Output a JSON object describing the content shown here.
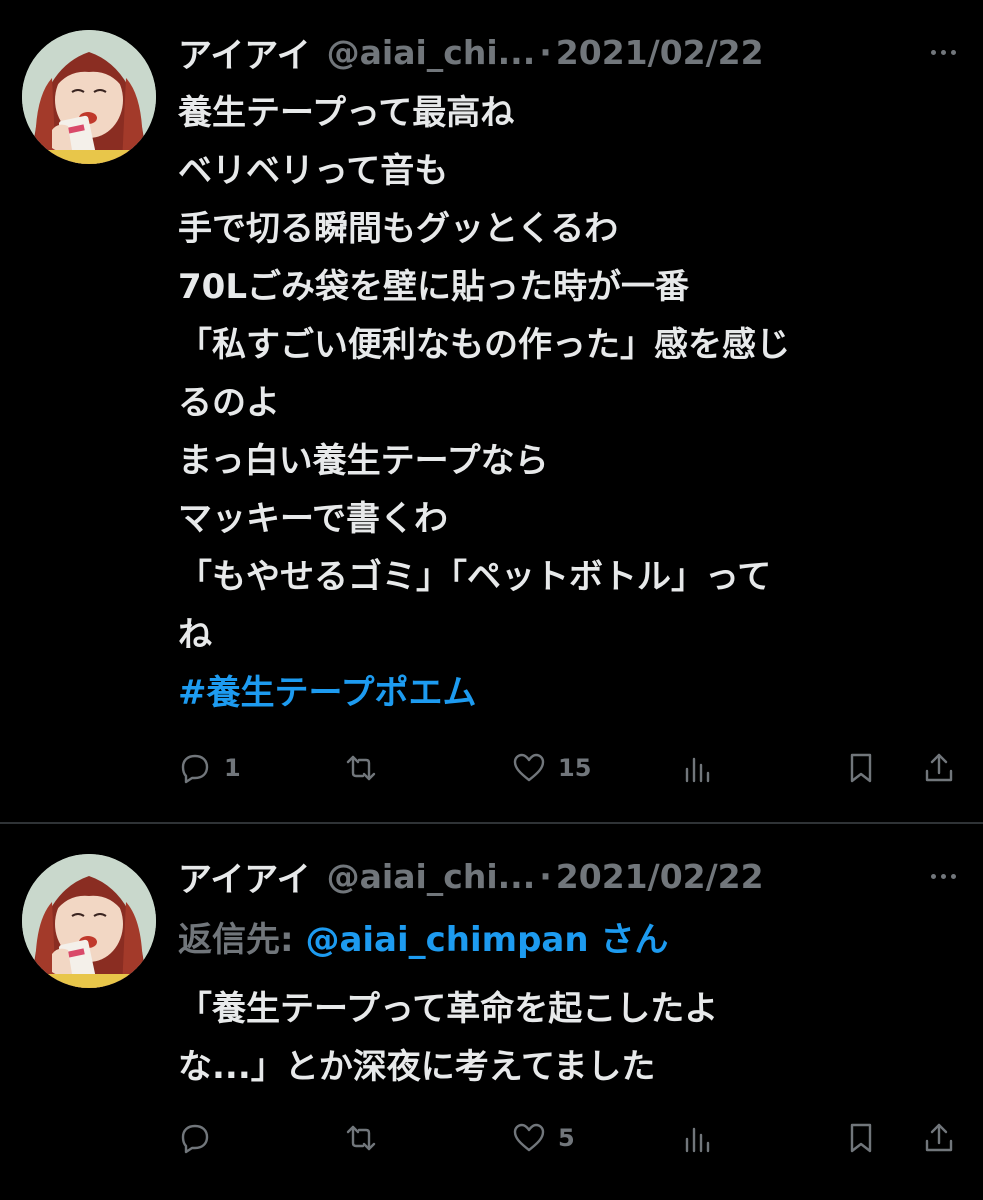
{
  "colors": {
    "background": "#000000",
    "text": "#e7e9ea",
    "muted": "#71767b",
    "accent": "#1d9bf0",
    "divider": "#2f3336"
  },
  "tweets": [
    {
      "name": "アイアイ",
      "handle": "@aiai_chi...",
      "separator": "·",
      "date": "2021/02/22",
      "lines": [
        "養生テープって最高ね",
        "ベリベリって音も",
        "手で切る瞬間もグッとくるわ",
        "70Lごみ袋を壁に貼った時が一番",
        "「私すごい便利なもの作った」感を感じ",
        "るのよ",
        "まっ白い養生テープなら",
        "マッキーで書くわ",
        "「もやせるゴミ」「ペットボトル」って",
        "ね"
      ],
      "hashtag": "#養生テープポエム",
      "reply_count": "1",
      "like_count": "15"
    },
    {
      "name": "アイアイ",
      "handle": "@aiai_chi...",
      "separator": "·",
      "date": "2021/02/22",
      "reply_to_label": "返信先: ",
      "reply_to_mention": "@aiai_chimpan",
      "reply_to_suffix": " さん",
      "lines": [
        "「養生テープって革命を起こしたよ",
        "な...」とか深夜に考えてました"
      ],
      "like_count": "5"
    }
  ],
  "icons": [
    "reply-icon",
    "retweet-icon",
    "like-icon",
    "views-icon",
    "bookmark-icon",
    "share-icon",
    "more-icon"
  ]
}
